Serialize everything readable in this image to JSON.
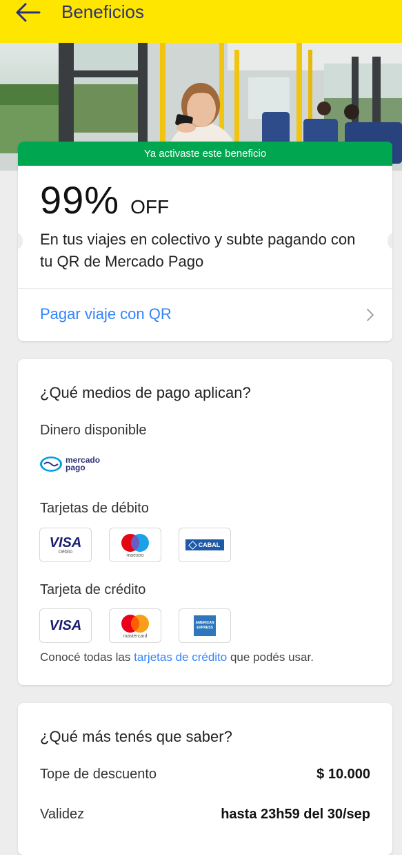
{
  "header": {
    "title": "Beneficios",
    "back_icon": "arrow-left-icon",
    "background_color": "#ffe600"
  },
  "benefit": {
    "banner": "Ya activaste este beneficio",
    "banner_color": "#00a650",
    "discount_value": "99%",
    "discount_suffix": "OFF",
    "description": "En tus viajes en colectivo y subte pagando con tu QR de Mercado Pago",
    "action_label": "Pagar viaje con QR",
    "action_icon": "chevron-right-icon",
    "link_color": "#3483fa"
  },
  "payment_methods": {
    "title": "¿Qué medios de pago aplican?",
    "available_money_label": "Dinero disponible",
    "mercadopago_logo_text_line1": "mercado",
    "mercadopago_logo_text_line2": "pago",
    "debit_label": "Tarjetas de débito",
    "debit_cards": [
      {
        "name": "VISA",
        "sublabel": "Débito"
      },
      {
        "name": "maestro"
      },
      {
        "name": "CABAL"
      }
    ],
    "credit_label": "Tarjeta de crédito",
    "credit_cards": [
      {
        "name": "VISA"
      },
      {
        "name": "mastercard"
      },
      {
        "name_line1": "AMERICAN",
        "name_line2": "EXPRESS"
      }
    ],
    "note_prefix": "Conocé todas las ",
    "note_link": "tarjetas de crédito",
    "note_suffix": " que podés usar."
  },
  "info": {
    "title": "¿Qué más tenés que saber?",
    "rows": [
      {
        "label": "Tope de descuento",
        "value": "$ 10.000"
      },
      {
        "label": "Validez",
        "value": "hasta 23h59 del 30/sep"
      }
    ]
  }
}
